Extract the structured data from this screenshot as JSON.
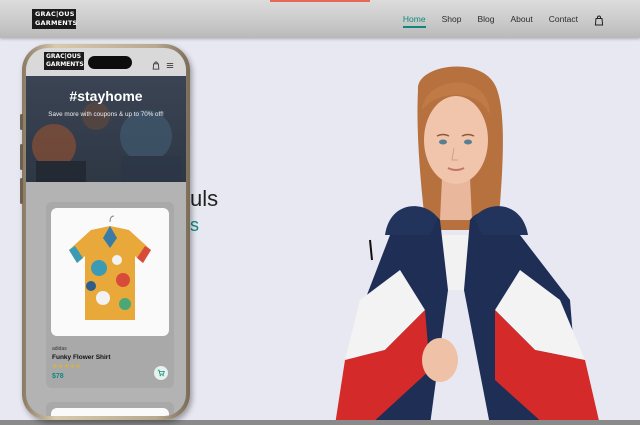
{
  "header": {
    "logo_line1": "GRAC|OUS",
    "logo_line2": "GARMENTS",
    "nav": [
      {
        "label": "Home",
        "active": true
      },
      {
        "label": "Shop"
      },
      {
        "label": "Blog"
      },
      {
        "label": "About"
      },
      {
        "label": "Contact"
      }
    ],
    "cart_icon": "shopping-bag-icon"
  },
  "hero": {
    "heading_fragment": "uls",
    "heading_fragment_teal": "s"
  },
  "phone": {
    "logo_line1": "GRAC|OUS",
    "logo_line2": "GARMENTS",
    "icons": [
      "shopping-bag-icon",
      "menu-icon"
    ],
    "banner": {
      "hashtag": "#stayhome",
      "subtitle": "Save more with coupons & up to 70% off!"
    },
    "product": {
      "brand": "adidas",
      "name": "Funky Flower Shirt",
      "rating_stars": 5,
      "stars_text": "★★★★★",
      "price": "$78"
    }
  },
  "colors": {
    "accent": "#0e8a7d",
    "star": "#e3b22a",
    "background": "#e8e8f2"
  }
}
